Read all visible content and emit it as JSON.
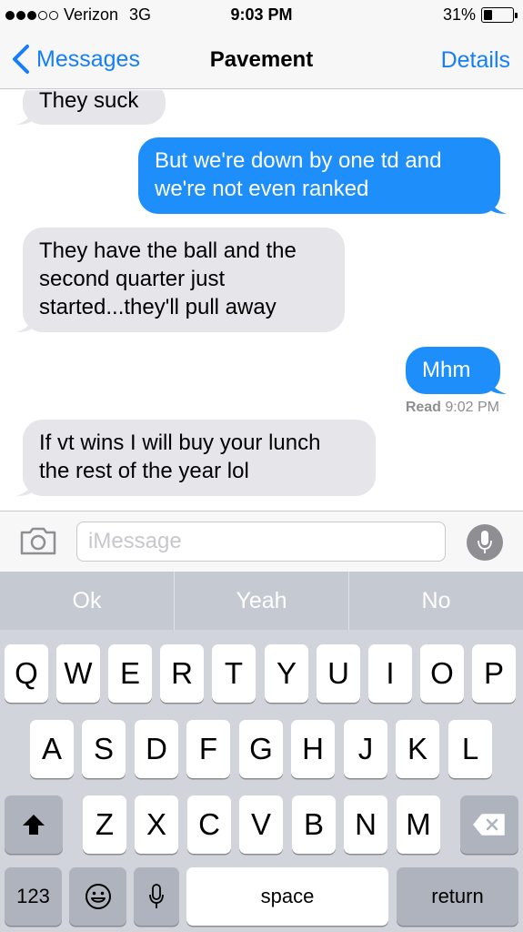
{
  "status": {
    "carrier": "Verizon",
    "network": "3G",
    "time": "9:03 PM",
    "battery_percent": "31%",
    "battery_level": 0.31
  },
  "nav": {
    "back_label": "Messages",
    "title": "Pavement",
    "details_label": "Details"
  },
  "messages": [
    {
      "direction": "in",
      "text": "They suck"
    },
    {
      "direction": "out",
      "lines": [
        "But we're down by one td and",
        "we're not even ranked"
      ]
    },
    {
      "direction": "in",
      "lines": [
        "They have the ball and the",
        "second quarter just",
        "started...they'll pull away"
      ]
    },
    {
      "direction": "out",
      "text": "Mhm"
    },
    {
      "direction": "in",
      "lines": [
        "If vt wins I will buy your lunch",
        "the rest of the year lol"
      ]
    }
  ],
  "read_receipt": {
    "label": "Read",
    "time": "9:02 PM"
  },
  "input": {
    "placeholder": "iMessage"
  },
  "suggestions": [
    "Ok",
    "Yeah",
    "No"
  ],
  "keyboard": {
    "row1": [
      "Q",
      "W",
      "E",
      "R",
      "T",
      "Y",
      "U",
      "I",
      "O",
      "P"
    ],
    "row2": [
      "A",
      "S",
      "D",
      "F",
      "G",
      "H",
      "J",
      "K",
      "L"
    ],
    "row3": [
      "Z",
      "X",
      "C",
      "V",
      "B",
      "N",
      "M"
    ],
    "numbers_label": "123",
    "space_label": "space",
    "return_label": "return"
  },
  "icons": {
    "signal": "signal-dots-icon",
    "battery": "battery-icon",
    "back": "chevron-left-icon",
    "camera": "camera-icon",
    "mic": "microphone-icon",
    "shift": "shift-icon",
    "delete": "delete-icon",
    "emoji": "emoji-icon",
    "dictation": "microphone-icon"
  },
  "colors": {
    "accent": "#157efb",
    "outgoing_bubble": "#1e8efa",
    "incoming_bubble": "#e5e5ea"
  }
}
